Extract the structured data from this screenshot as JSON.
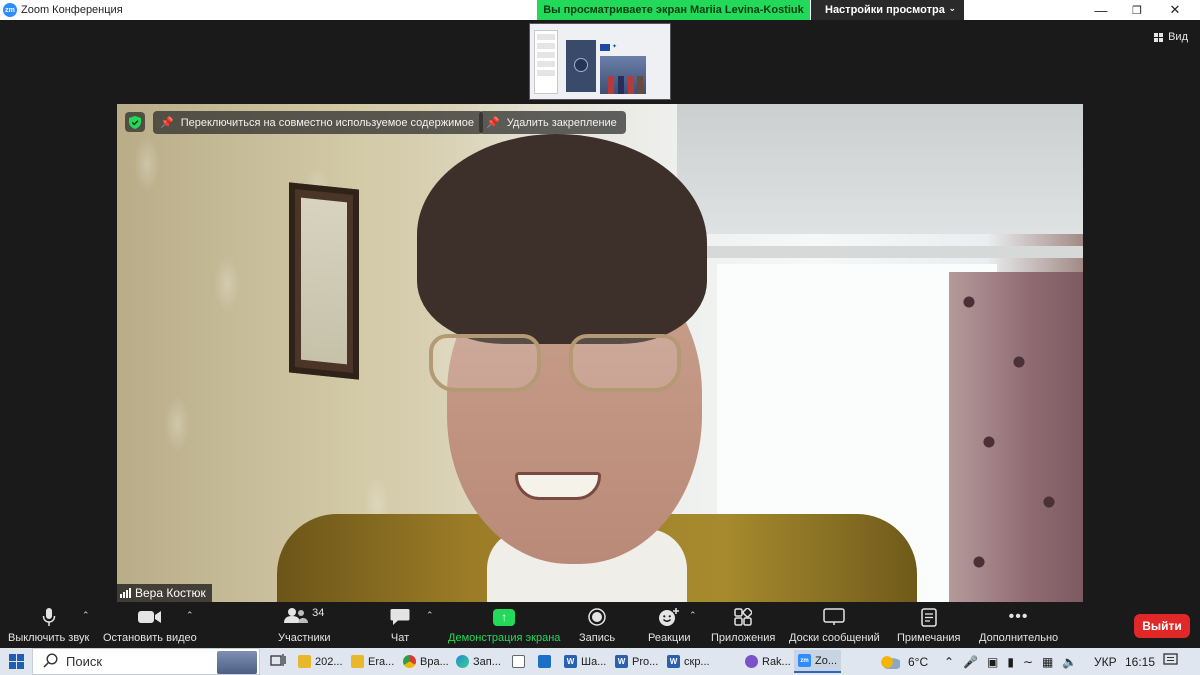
{
  "window": {
    "app_title": "Zoom Конференция",
    "share_banner": "Вы просматриваете экран Mariia Levina-Kostiuk",
    "view_settings": "Настройки просмотра",
    "view_label": "Вид"
  },
  "video": {
    "switch_shared_content": "Переключиться на совместно используемое содержимое",
    "remove_pin": "Удалить закрепление",
    "participant_name": "Вера Костюк"
  },
  "toolbar": {
    "mute": "Выключить звук",
    "stop_video": "Остановить видео",
    "participants": "Участники",
    "participants_count": "34",
    "chat": "Чат",
    "share_screen": "Демонстрация экрана",
    "record": "Запись",
    "reactions": "Реакции",
    "apps": "Приложения",
    "whiteboards": "Доски сообщений",
    "notes": "Примечания",
    "more": "Дополнительно",
    "leave": "Выйти"
  },
  "taskbar": {
    "search": "Поиск",
    "apps": [
      {
        "label": "202...",
        "icon": "folder-icon",
        "color": "#e8b82c"
      },
      {
        "label": "Era...",
        "icon": "folder-icon",
        "color": "#e8b82c"
      },
      {
        "label": "Вра...",
        "icon": "chrome-icon",
        "color": "#d93b30"
      },
      {
        "label": "Зап...",
        "icon": "edge-icon",
        "color": "#1c8bd1"
      },
      {
        "label": "Ша...",
        "icon": "word-icon",
        "color": "#2b5faf"
      },
      {
        "label": "Pro...",
        "icon": "word-icon",
        "color": "#2b5faf"
      },
      {
        "label": "скр...",
        "icon": "word-icon",
        "color": "#2b5faf"
      },
      {
        "label": "Rak...",
        "icon": "viber-icon",
        "color": "#7c51c9"
      },
      {
        "label": "Zo...",
        "icon": "zoom-icon",
        "color": "#2d8cff"
      }
    ],
    "temperature": "6°C",
    "language": "УКР",
    "time": "16:15"
  }
}
